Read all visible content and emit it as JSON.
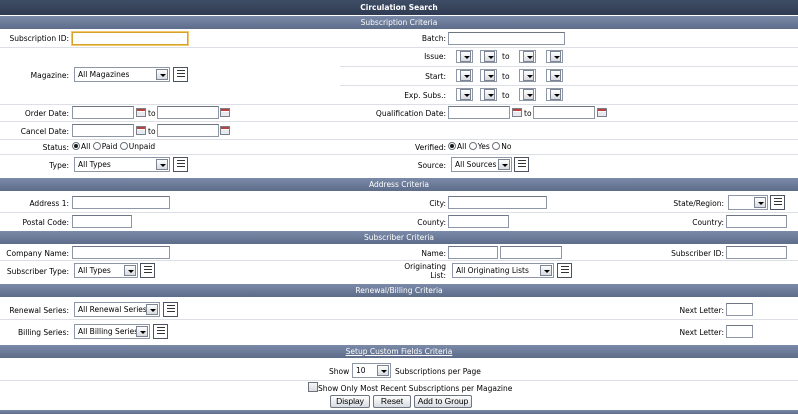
{
  "title": "Circulation Search",
  "sections": {
    "subscription": "Subscription Criteria",
    "address": "Address Criteria",
    "subscriber": "Subscriber Criteria",
    "renewal": "Renewal/Billing Criteria",
    "custom": "Setup Custom Fields Criteria"
  },
  "labels": {
    "subscription_id": "Subscription ID:",
    "batch": "Batch:",
    "issue": "Issue:",
    "magazine": "Magazine:",
    "start": "Start:",
    "exp_subs": "Exp. Subs.:",
    "order_date": "Order Date:",
    "qualification_date": "Qualification Date:",
    "cancel_date": "Cancel Date:",
    "status": "Status:",
    "verified": "Verified:",
    "type": "Type:",
    "source": "Source:",
    "address1": "Address 1:",
    "city": "City:",
    "state_region": "State/Region:",
    "postal_code": "Postal Code:",
    "county": "County:",
    "country": "Country:",
    "company_name": "Company Name:",
    "name": "Name:",
    "subscriber_id": "Subscriber ID:",
    "subscriber_type": "Subscriber Type:",
    "originating_list": "Originating\nList:",
    "renewal_series": "Renewal Series:",
    "billing_series": "Billing Series:",
    "next_letter": "Next Letter:",
    "to": "to",
    "show": "Show",
    "per_page": "Subscriptions per Page",
    "most_recent": "Show Only Most Recent Subscriptions per Magazine"
  },
  "selects": {
    "magazine": "All Magazines",
    "type": "All Types",
    "source": "All Sources",
    "subscriber_type": "All Types",
    "originating_list": "All Originating Lists",
    "renewal_series": "All Renewal Series",
    "billing_series": "All Billing Series",
    "page_size": "10"
  },
  "status_options": [
    "All",
    "Paid",
    "Unpaid"
  ],
  "verified_options": [
    "All",
    "Yes",
    "No"
  ],
  "buttons": {
    "display": "Display",
    "reset": "Reset",
    "add_to_group": "Add to Group"
  }
}
